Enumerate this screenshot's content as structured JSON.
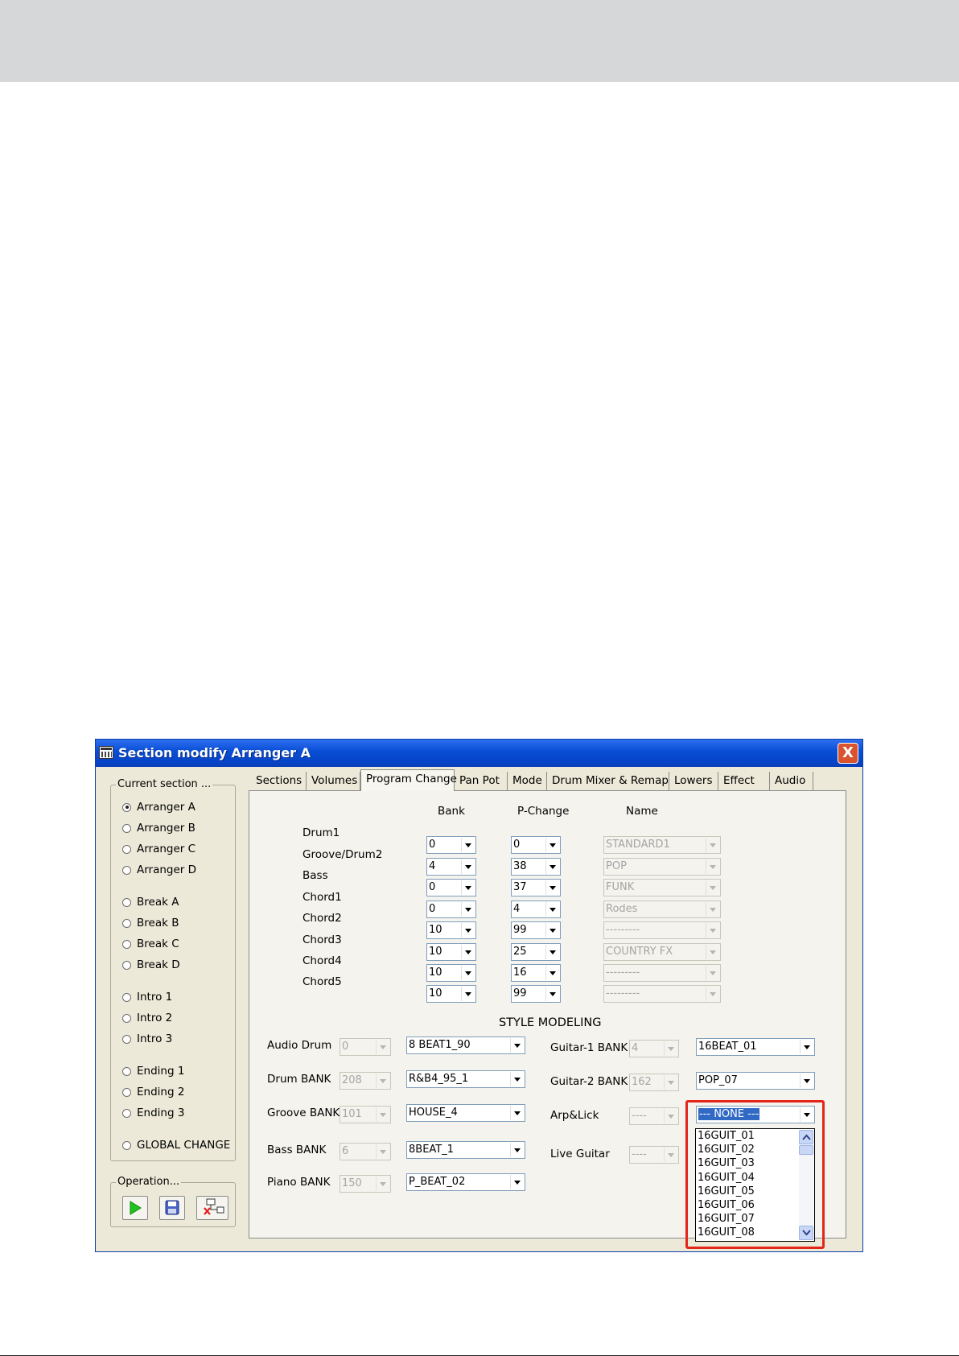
{
  "window": {
    "title": "Section modify Arranger A",
    "close_label": "X"
  },
  "current_section": {
    "legend": "Current section ...",
    "options": [
      "Arranger A",
      "Arranger B",
      "Arranger C",
      "Arranger D",
      "Break A",
      "Break B",
      "Break C",
      "Break D",
      "Intro 1",
      "Intro 2",
      "Intro 3",
      "Ending 1",
      "Ending 2",
      "Ending 3",
      "GLOBAL CHANGE"
    ],
    "selected": "Arranger A"
  },
  "operation": {
    "legend": "Operation...",
    "buttons": [
      "play-icon",
      "save-icon",
      "delete-icon"
    ]
  },
  "tabs": [
    "Sections",
    "Volumes",
    "Program Change",
    "Pan Pot",
    "Mode",
    "Drum Mixer & Remap",
    "Lowers",
    "Effect",
    "Audio"
  ],
  "active_tab": "Program Change",
  "program_change": {
    "headers": {
      "bank": "Bank",
      "pchange": "P-Change",
      "name": "Name"
    },
    "rows": [
      {
        "label": "Drum1",
        "bank": "0",
        "pchange": "0",
        "name": "STANDARD1"
      },
      {
        "label": "Groove/Drum2",
        "bank": "4",
        "pchange": "38",
        "name": "POP"
      },
      {
        "label": "Bass",
        "bank": "0",
        "pchange": "37",
        "name": "FUNK"
      },
      {
        "label": "Chord1",
        "bank": "0",
        "pchange": "4",
        "name": "Rodes"
      },
      {
        "label": "Chord2",
        "bank": "10",
        "pchange": "99",
        "name": "---------"
      },
      {
        "label": "Chord3",
        "bank": "10",
        "pchange": "25",
        "name": "COUNTRY FX"
      },
      {
        "label": "Chord4",
        "bank": "10",
        "pchange": "16",
        "name": "---------"
      },
      {
        "label": "Chord5",
        "bank": "10",
        "pchange": "99",
        "name": "---------"
      }
    ]
  },
  "style_modeling": {
    "title": "STYLE MODELING",
    "left": [
      {
        "label": "Audio Drum",
        "num": "0",
        "value": "8 BEAT1_90"
      },
      {
        "label": "Drum BANK",
        "num": "208",
        "value": "R&B4_95_1"
      },
      {
        "label": "Groove BANK",
        "num": "101",
        "value": "HOUSE_4"
      },
      {
        "label": "Bass BANK",
        "num": "6",
        "value": "8BEAT_1"
      },
      {
        "label": "Piano BANK",
        "num": "150",
        "value": "P_BEAT_02"
      }
    ],
    "right": [
      {
        "label": "Guitar-1 BANK",
        "num": "4",
        "value": "16BEAT_01"
      },
      {
        "label": "Guitar-2 BANK",
        "num": "162",
        "value": "POP_07"
      },
      {
        "label": "Arp&Lick",
        "num": "----",
        "value": "--- NONE ---"
      },
      {
        "label": "Live Guitar",
        "num": "----"
      }
    ],
    "dropdown_items": [
      "16GUIT_01",
      "16GUIT_02",
      "16GUIT_03",
      "16GUIT_04",
      "16GUIT_05",
      "16GUIT_06",
      "16GUIT_07",
      "16GUIT_08"
    ]
  },
  "colors": {
    "titlebar": "#0a4fd6",
    "dialog": "#ece9d8",
    "highlight": "#e3251b",
    "selection": "#316ac5"
  }
}
